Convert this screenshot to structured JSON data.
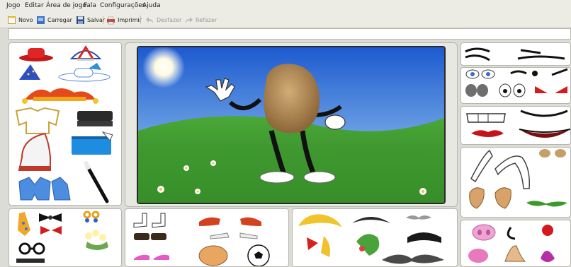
{
  "menu": {
    "jogo": "Jogo",
    "editar": "Editar",
    "area": "Área de jogo",
    "fala": "Fala",
    "config": "Configurações",
    "ajuda": "Ajuda"
  },
  "toolbar": {
    "novo": "Novo",
    "carregar": "Carregar",
    "salvar": "Salvar",
    "imprimir": "Imprimir",
    "desfazer": "Desfazer",
    "refazer": "Refazer"
  },
  "colors": {
    "sky_top": "#1e5fd1",
    "sky_bottom": "#9fd0f0",
    "grass": "#3f9a2c",
    "potato": "#b9925e"
  },
  "palettes": {
    "left_top": [
      "red-hat-icon",
      "umbrella-hat-icon",
      "wizard-hat-icon",
      "sun-hat-icon",
      "jester-hat-icon",
      "white-shirt-icon",
      "black-shorts-icon",
      "white-dress-icon",
      "blue-skirt-icon",
      "blue-jacket-icon",
      "cane-icon"
    ],
    "left_bottom": [
      "tie-icon",
      "bow-tie-icon",
      "earrings-icon",
      "red-bow-icon",
      "flowers-icon",
      "glasses-icon"
    ],
    "shoes": [
      "white-boots-icon",
      "red-slippers-icon",
      "black-shoes-icon",
      "sneaker-icon",
      "pink-shoes-icon",
      "football-icon",
      "rugby-ball-icon"
    ],
    "hair": [
      "blonde-wig-icon",
      "black-wig-icon",
      "red-bow-hair-icon",
      "mustache-icon",
      "green-hair-icon",
      "black-hair-icon"
    ],
    "eyebrows": [
      "eyebrows-icon"
    ],
    "eyes": [
      "blue-eyes-icon",
      "eyes-icon"
    ],
    "mouths": [
      "teeth-mouth-icon",
      "lips-icon",
      "smile-mouth-icon"
    ],
    "arms": [
      "arm-icon",
      "ear-icon",
      "green-leaves-icon"
    ],
    "noses": [
      "pig-nose-icon",
      "nose-icon",
      "red-nose-icon"
    ]
  }
}
